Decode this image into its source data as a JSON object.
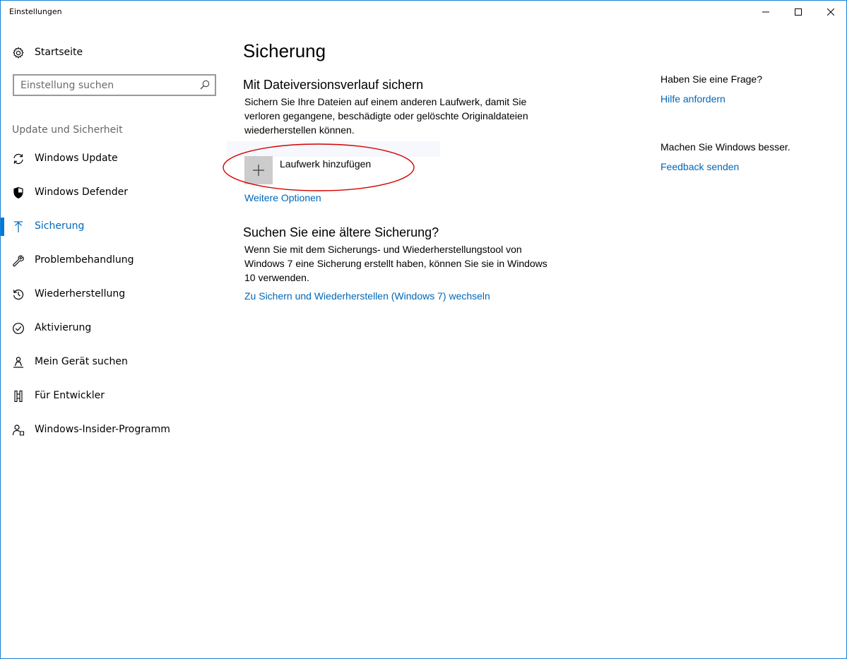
{
  "window": {
    "title": "Einstellungen"
  },
  "sidebar": {
    "home_label": "Startseite",
    "search_placeholder": "Einstellung suchen",
    "group_label": "Update und Sicherheit",
    "items": [
      {
        "label": "Windows Update",
        "icon": "refresh-icon"
      },
      {
        "label": "Windows Defender",
        "icon": "shield-icon"
      },
      {
        "label": "Sicherung",
        "icon": "arrow-up-icon",
        "active": true
      },
      {
        "label": "Problembehandlung",
        "icon": "wrench-icon"
      },
      {
        "label": "Wiederherstellung",
        "icon": "history-icon"
      },
      {
        "label": "Aktivierung",
        "icon": "checkmark-circle-icon"
      },
      {
        "label": "Mein Gerät suchen",
        "icon": "person-location-icon"
      },
      {
        "label": "Für Entwickler",
        "icon": "developer-tools-icon"
      },
      {
        "label": "Windows-Insider-Programm",
        "icon": "insider-person-icon"
      }
    ]
  },
  "main": {
    "title": "Sicherung",
    "filehistory": {
      "heading": "Mit Dateiversionsverlauf sichern",
      "description": "Sichern Sie Ihre Dateien auf einem anderen Laufwerk, damit Sie verloren gegangene, beschädigte oder gelöschte Originaldateien wiederherstellen können.",
      "add_drive_label": "Laufwerk hinzufügen",
      "more_options_label": "Weitere Optionen"
    },
    "older_backup": {
      "heading": "Suchen Sie eine ältere Sicherung?",
      "description": "Wenn Sie mit dem Sicherungs- und Wiederherstellungstool von Windows 7 eine Sicherung erstellt haben, können Sie sie in Windows 10 verwenden.",
      "link_label": "Zu Sichern und Wiederherstellen (Windows 7) wechseln"
    }
  },
  "aside": {
    "question": "Haben Sie eine Frage?",
    "help_link": "Hilfe anfordern",
    "improve": "Machen Sie Windows besser.",
    "feedback_link": "Feedback senden"
  },
  "colors": {
    "accent": "#0078d7",
    "link": "#0067b8",
    "annotation": "#d40000"
  }
}
